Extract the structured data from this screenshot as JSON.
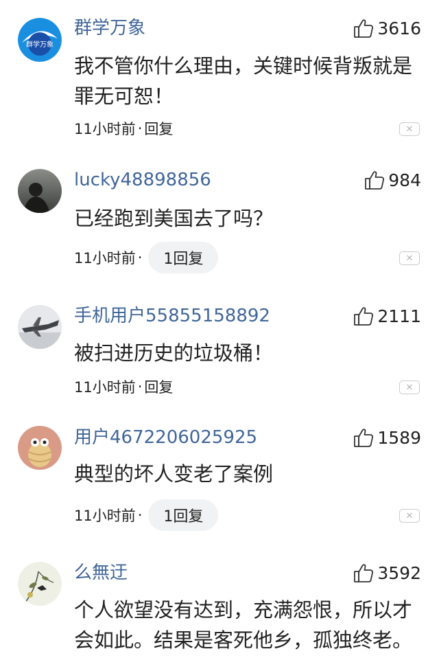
{
  "comments": [
    {
      "username": "群学万象",
      "likes": "3616",
      "body": "我不管你什么理由，关键时候背叛就是罪无可恕！",
      "time": "11小时前",
      "reply": "回复",
      "avatar_text": "群学万象"
    },
    {
      "username": "lucky48898856",
      "likes": "984",
      "body": "已经跑到美国去了吗？",
      "time": "11小时前",
      "reply": "1回复"
    },
    {
      "username": "手机用户55855158892",
      "likes": "2111",
      "body": "被扫进历史的垃圾桶！",
      "time": "11小时前",
      "reply": "回复"
    },
    {
      "username": "用户4672206025925",
      "likes": "1589",
      "body": "典型的坏人变老了案例",
      "time": "11小时前",
      "reply": "1回复"
    },
    {
      "username": "么無迂",
      "likes": "3592",
      "body": "个人欲望没有达到，充满怨恨，所以才会如此。结果是客死他乡，孤独终老。"
    }
  ],
  "separator": "·",
  "icons": {
    "like": "thumbs-up-icon",
    "dismiss": "close-icon"
  },
  "colors": {
    "username": "#406599",
    "reply_pill_bg": "#f1f2f3",
    "text": "#222222"
  }
}
